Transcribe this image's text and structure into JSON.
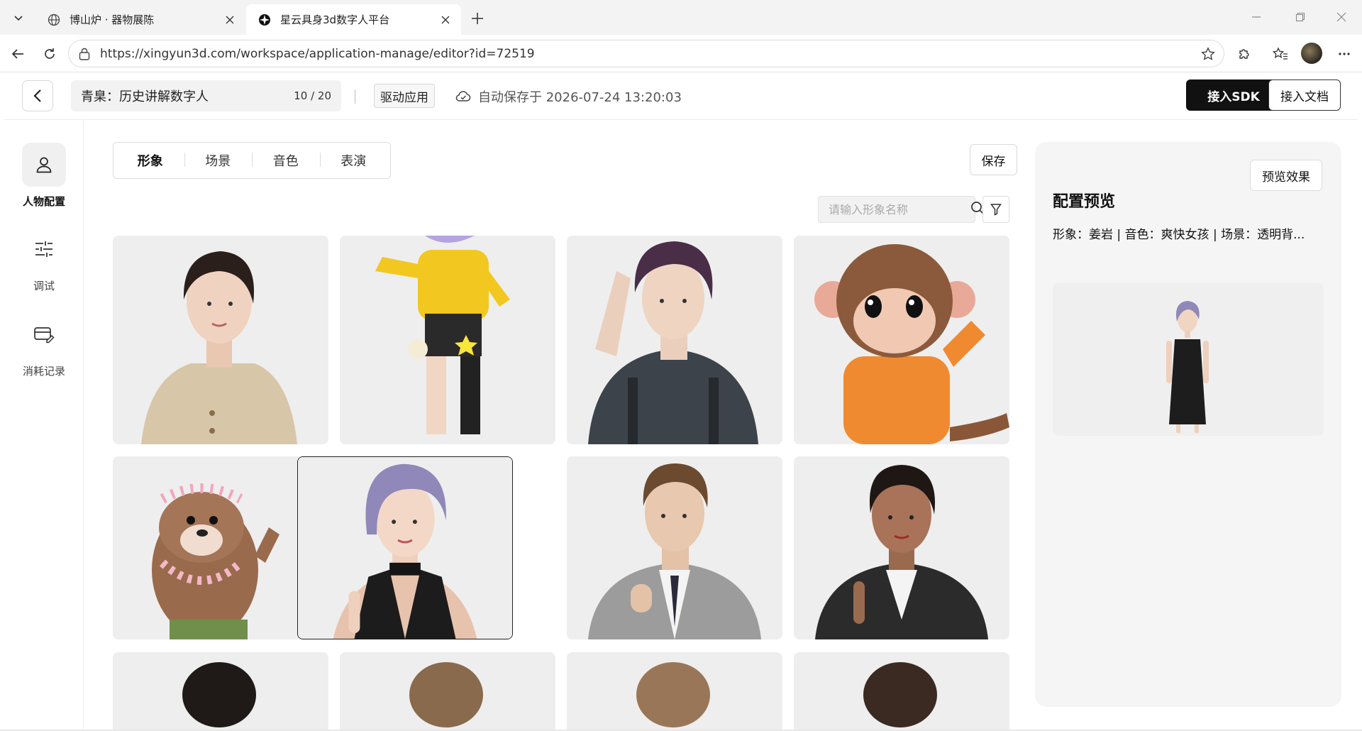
{
  "browser": {
    "tabs": [
      {
        "title": "博山炉 · 器物展陈",
        "active": false,
        "icon": "globe-icon"
      },
      {
        "title": "星云具身3d数字人平台",
        "active": true,
        "icon": "app-logo-icon"
      }
    ],
    "url": "https://xingyun3d.com/workspace/application-manage/editor?id=72519"
  },
  "header": {
    "app_name": "青臬：历史讲解数字人",
    "name_count": "10 / 20",
    "drive_label": "驱动应用",
    "autosave_text": "自动保存于 2026-07-24 13:20:03",
    "sdk_button": "接入SDK",
    "doc_button": "接入文档"
  },
  "sidebar": {
    "items": [
      {
        "label": "人物配置",
        "icon": "person-icon",
        "active": true
      },
      {
        "label": "调试",
        "icon": "sliders-icon",
        "active": false
      },
      {
        "label": "消耗记录",
        "icon": "card-edit-icon",
        "active": false
      }
    ]
  },
  "main": {
    "tabs": [
      {
        "label": "形象",
        "active": true
      },
      {
        "label": "场景",
        "active": false
      },
      {
        "label": "音色",
        "active": false
      },
      {
        "label": "表演",
        "active": false
      }
    ],
    "save_button": "保存",
    "search_placeholder": "请输入形象名称",
    "avatars": [
      {
        "name": "woman-beige-sweater",
        "selected": false
      },
      {
        "name": "anime-girl-yellow-jacket",
        "selected": false
      },
      {
        "name": "young-man-curly-hair",
        "selected": false
      },
      {
        "name": "cartoon-monkey",
        "selected": false
      },
      {
        "name": "cartoon-otter-flower-crown",
        "selected": false
      },
      {
        "name": "woman-purple-hair",
        "selected": true
      },
      {
        "name": "man-grey-suit",
        "selected": false
      },
      {
        "name": "woman-leather-jacket",
        "selected": false
      }
    ]
  },
  "preview": {
    "button": "预览效果",
    "title": "配置预览",
    "summary": "形象：姜岩 | 音色：爽快女孩 | 场景：透明背..."
  },
  "colors": {
    "accent": "#111111",
    "panel_bg": "#f5f5f5",
    "card_bg": "#efefef"
  }
}
